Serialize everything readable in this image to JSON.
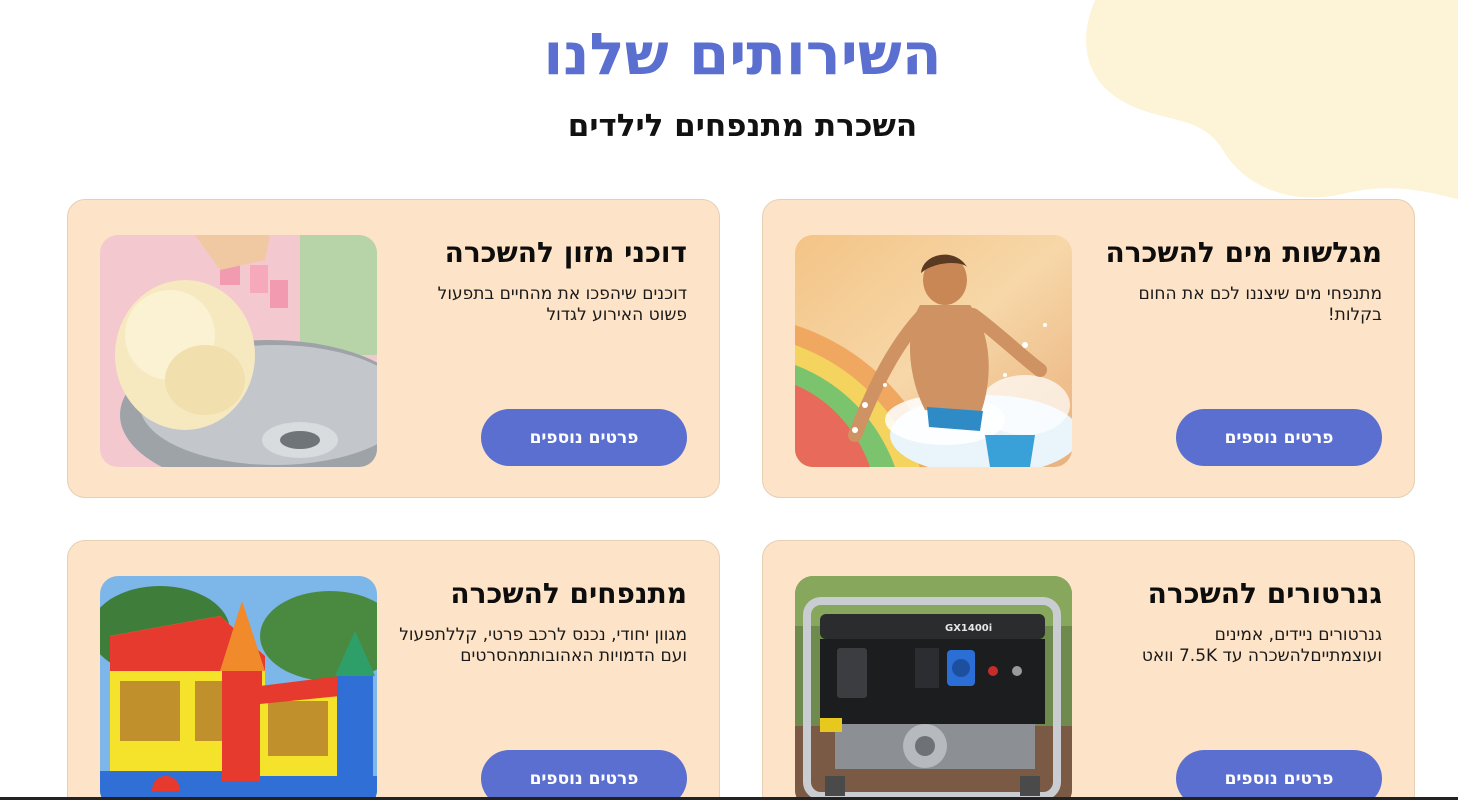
{
  "header": {
    "title": "השירותים שלנו",
    "subtitle": "השכרת מתנפחים לילדים"
  },
  "colors": {
    "accent": "#5a6fd0",
    "card_background": "#fde3c7",
    "blob": "#fdf3d6"
  },
  "services": [
    {
      "title": "מגלשות מים להשכרה",
      "description": "מתנפחי מים שיצננו לכם את החום בקלות!",
      "button_label": "פרטים נוספים",
      "image": "boy-on-water-slide"
    },
    {
      "title": "דוכני מזון להשכרה",
      "description": "דוכנים שיהפכו את מהחיים בתפעול פשוט האירוע לגדול",
      "button_label": "פרטים נוספים",
      "image": "cotton-candy-machine"
    },
    {
      "title": "גנרטורים להשכרה",
      "description": "גנרטורים ניידים, אמינים ועוצמתייםלהשכרה עד 7.5K וואט",
      "button_label": "פרטים נוספים",
      "image": "portable-generator",
      "image_text": "GX1400i"
    },
    {
      "title": "מתנפחים להשכרה",
      "description": "מגוון יחודי, נכנס לרכב פרטי, קללתפעול ועם הדמויות האהובותמהסרטים",
      "button_label": "פרטים נוספים",
      "image": "bouncy-castle"
    }
  ]
}
